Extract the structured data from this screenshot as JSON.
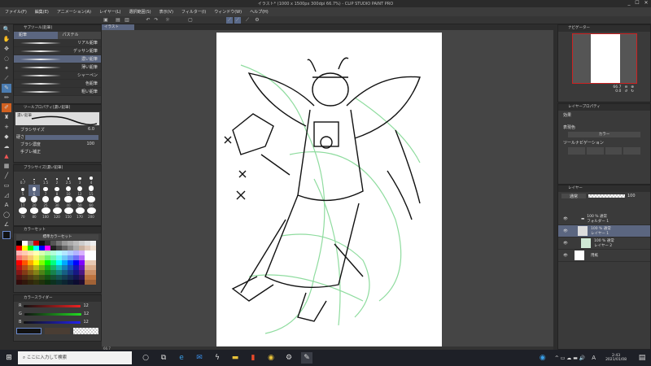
{
  "window": {
    "title": "イラスト* (1000 x 1500px 300dpi 66.7%) - CLIP STUDIO PAINT PRO",
    "controls": [
      "_",
      "☐",
      "✕"
    ]
  },
  "menu": [
    "ファイル(F)",
    "編集(E)",
    "アニメーション(A)",
    "レイヤー(L)",
    "選択範囲(S)",
    "表示(V)",
    "フィルター(I)",
    "ウィンドウ(W)",
    "ヘルプ(H)"
  ],
  "canvas_tab": "イラスト",
  "subtool": {
    "title": "サブツール[鉛筆]",
    "groups": [
      "鉛筆",
      "パステル"
    ],
    "items": [
      "リアル鉛筆",
      "デッサン鉛筆",
      "濃い鉛筆",
      "薄い鉛筆",
      "シャーペン",
      "色鉛筆",
      "粗い鉛筆"
    ],
    "selected": 2
  },
  "toolprop": {
    "title": "ツールプロパティ[濃い鉛筆]",
    "preview_label": "濃い鉛筆",
    "brush_size_label": "ブラシサイズ",
    "brush_size": "6.0",
    "shape_label": "硬さ",
    "density_label": "ブラシ濃度",
    "density": "100",
    "stabilize_label": "手ブレ補正"
  },
  "brushsize": {
    "title": "ブラシサイズ[濃い鉛筆]",
    "sizes": [
      "0.7",
      "1",
      "1.5",
      "2",
      "2.5",
      "3",
      "4",
      "5",
      "6",
      "7",
      "8",
      "10",
      "12",
      "15",
      "17",
      "20",
      "25",
      "30",
      "40",
      "50",
      "60",
      "70",
      "80",
      "100",
      "120",
      "150",
      "170",
      "200"
    ],
    "selected": "6"
  },
  "colorset": {
    "title": "カラーセット",
    "set_name": "標準カラーセット"
  },
  "colorslider": {
    "title": "カラースライダー",
    "r": "12",
    "g": "12",
    "b": "12",
    "labels": [
      "R",
      "G",
      "B"
    ]
  },
  "colors": {
    "main": "#121212",
    "sub": "#4a3d33",
    "accent": "#5b6680"
  },
  "status": {
    "zoom": "66.7",
    "angle": "0.0"
  },
  "navigator": {
    "title": "ナビゲーター",
    "zoom": "66.7",
    "angle": "0.0"
  },
  "layerprop": {
    "title": "レイヤープロパティ",
    "effect_label": "効果",
    "expression_label": "表現色",
    "expression_value": "カラー",
    "toolnav_label": "ツールナビゲーション"
  },
  "layers": {
    "title": "レイヤー",
    "blend": "通常",
    "opacity": "100",
    "items": [
      {
        "meta": "100 % 通常",
        "name": "フォルダー 1",
        "type": "folder"
      },
      {
        "meta": "100 % 通常",
        "name": "レイヤー 1",
        "type": "raster",
        "selected": true
      },
      {
        "meta": "100 % 通常",
        "name": "レイヤー 2",
        "type": "raster"
      },
      {
        "meta": "",
        "name": "用紙",
        "type": "paper"
      }
    ]
  },
  "taskbar": {
    "search_placeholder": "ここに入力して検索",
    "time": "2:43",
    "date": "2021/01/08",
    "ime": "A"
  }
}
